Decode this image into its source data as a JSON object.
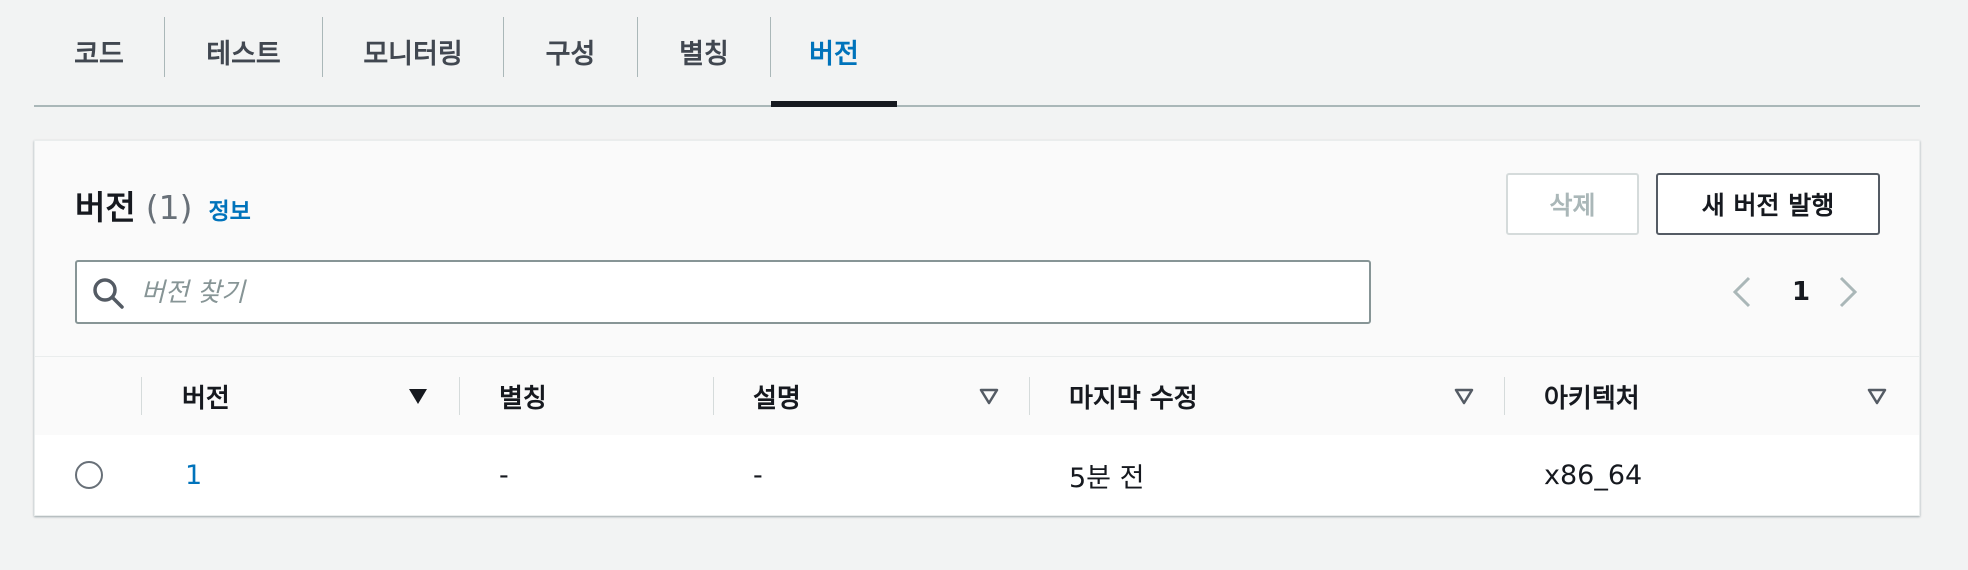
{
  "tabs": {
    "items": [
      {
        "label": "코드"
      },
      {
        "label": "테스트"
      },
      {
        "label": "모니터링"
      },
      {
        "label": "구성"
      },
      {
        "label": "별칭"
      },
      {
        "label": "버전"
      }
    ],
    "active": "버전"
  },
  "panel": {
    "title": "버전",
    "count": "(1)",
    "info_label": "정보",
    "delete_label": "삭제",
    "publish_label": "새 버전 발행",
    "search_placeholder": "버전 찾기",
    "pagination": {
      "current_page": "1"
    }
  },
  "table": {
    "headers": {
      "version": "버전",
      "alias": "별칭",
      "description": "설명",
      "last_modified": "마지막 수정",
      "architecture": "아키텍처"
    },
    "rows": [
      {
        "version": "1",
        "alias": "-",
        "description": "-",
        "last_modified": "5분 전",
        "architecture": "x86_64",
        "selected": false
      }
    ]
  },
  "colors": {
    "accent": "#0073bb",
    "text": "#16191f",
    "muted": "#687078",
    "disabled": "#aab7b8",
    "page_background": "#f2f3f3"
  },
  "icons": [
    "search-icon",
    "chevron-left-icon",
    "chevron-right-icon",
    "sort-descending-icon",
    "sort-icon",
    "radio-icon"
  ]
}
